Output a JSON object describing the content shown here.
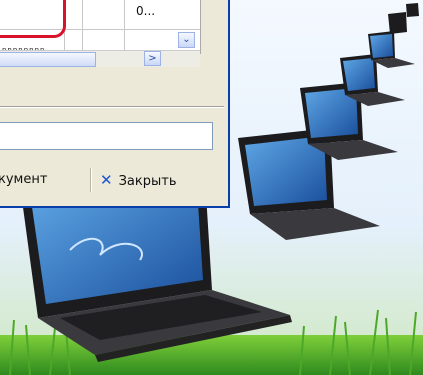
{
  "grid": {
    "cell_value": "0...",
    "tiny_text": "nnnnnnnn"
  },
  "scroll": {
    "down_arrow": "⌄",
    "right_arrow": ">"
  },
  "toolbar": {
    "document_label": "кумент",
    "close_icon": "✕",
    "close_label": "Закрыть"
  },
  "colors": {
    "highlight": "#d9122b",
    "window_border": "#0a3ea8",
    "grass": "#3fa02a"
  },
  "icons": [
    "chevron-down-icon",
    "chevron-right-icon",
    "close-icon",
    "laptop-image"
  ]
}
